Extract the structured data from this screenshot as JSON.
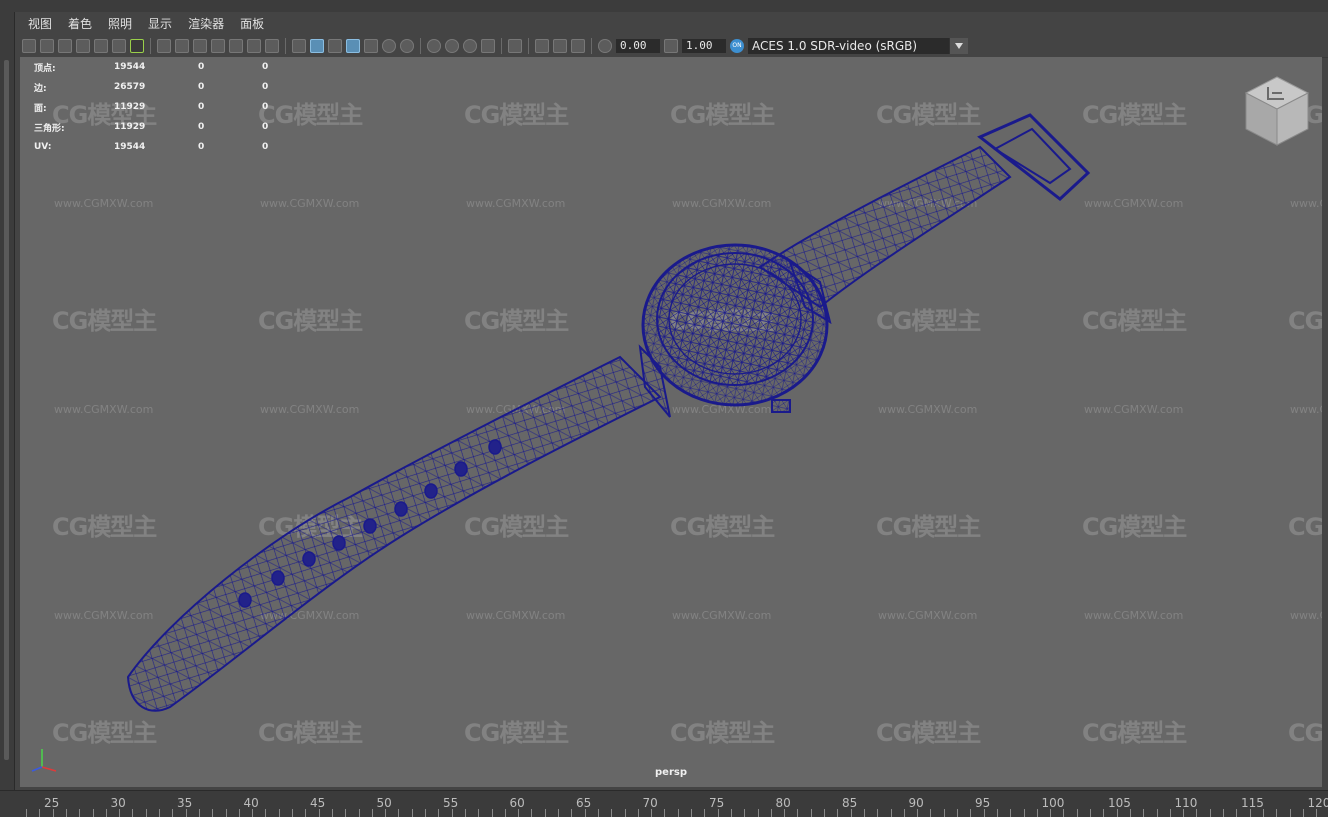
{
  "menu": [
    "视图",
    "着色",
    "照明",
    "显示",
    "渲染器",
    "面板"
  ],
  "toolbar": {
    "exposure_value": "0.00",
    "gamma_value": "1.00",
    "colorspace_badge": "ON",
    "colorspace_selected": "ACES 1.0 SDR-video (sRGB)",
    "icons": [
      "camera-select-icon",
      "camera-attributes-icon",
      "bookmark-icon",
      "image-plane-icon",
      "grease-pencil-icon",
      "2d-pan-zoom-icon",
      "grid-icon",
      "film-gate-icon",
      "resolution-gate-icon",
      "gate-mask-icon",
      "field-chart-icon",
      "safe-action-icon",
      "safe-title-icon",
      "wireframe-icon",
      "smooth-shade-icon",
      "wireframe-on-shaded-icon",
      "textured-icon",
      "use-all-lights-icon",
      "shadows-icon",
      "screen-space-ao-icon",
      "motion-blur-icon",
      "anti-aliasing-icon",
      "depth-of-field-icon",
      "isolate-select-icon",
      "xray-icon",
      "xray-joints-icon",
      "xray-components-icon",
      "exposure-icon",
      "gamma-icon",
      "colorspace-icon"
    ]
  },
  "hud": {
    "rows": [
      {
        "label": "顶点:",
        "v1": "19544",
        "v2": "0",
        "v3": "0"
      },
      {
        "label": "边:",
        "v1": "26579",
        "v2": "0",
        "v3": "0"
      },
      {
        "label": "面:",
        "v1": "11929",
        "v2": "0",
        "v3": "0"
      },
      {
        "label": "三角形:",
        "v1": "11929",
        "v2": "0",
        "v3": "0"
      },
      {
        "label": "UV:",
        "v1": "19544",
        "v2": "0",
        "v3": "0"
      }
    ]
  },
  "viewport": {
    "camera": "persp",
    "watermark_logo": "CG模型主",
    "watermark_url": "www.CGMXW.com",
    "wire_color": "#1a1a8c",
    "background_color": "#676767"
  },
  "timeline": {
    "ticks": [
      "25",
      "30",
      "35",
      "40",
      "45",
      "50",
      "55",
      "60",
      "65",
      "70",
      "75",
      "80",
      "85",
      "90",
      "95",
      "100",
      "105",
      "110",
      "115",
      "120"
    ]
  }
}
